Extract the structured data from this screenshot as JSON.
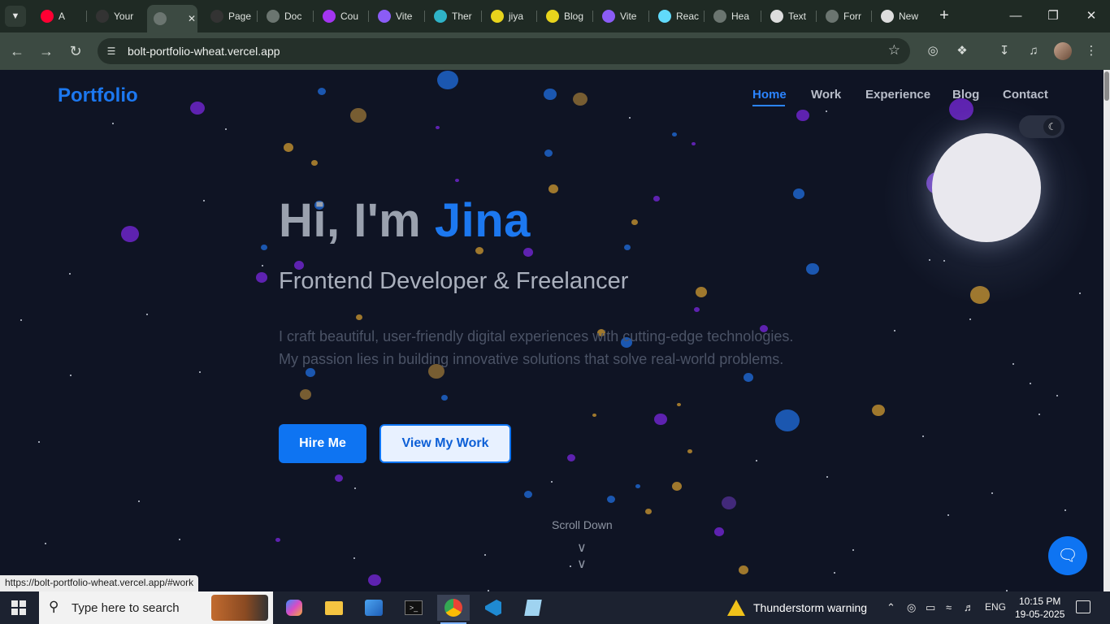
{
  "browser": {
    "tabs": [
      {
        "label": "A",
        "icon": "youtube-music-icon",
        "color": "#ff0033"
      },
      {
        "label": "Your",
        "icon": "github-icon",
        "color": "#333333"
      },
      {
        "label": "",
        "icon": "globe-icon",
        "color": "#6b7570",
        "active": true
      },
      {
        "label": "Page",
        "icon": "github-icon",
        "color": "#333333"
      },
      {
        "label": "Doc",
        "icon": "globe-icon",
        "color": "#6b7570"
      },
      {
        "label": "Cou",
        "icon": "udemy-icon",
        "color": "#a435f0"
      },
      {
        "label": "Vite",
        "icon": "vite-icon",
        "color": "#8b5cf6"
      },
      {
        "label": "Ther",
        "icon": "bot-icon",
        "color": "#2fb3c8"
      },
      {
        "label": "jiya",
        "icon": "bookmark-icon",
        "color": "#e8d41c"
      },
      {
        "label": "Blog",
        "icon": "bookmark-icon",
        "color": "#e8d41c"
      },
      {
        "label": "Vite",
        "icon": "vite-icon",
        "color": "#8b5cf6"
      },
      {
        "label": "Reac",
        "icon": "react-icon",
        "color": "#61dafb"
      },
      {
        "label": "Hea",
        "icon": "globe-icon",
        "color": "#6b7570"
      },
      {
        "label": "Text",
        "icon": "doc-icon",
        "color": "#dddddd"
      },
      {
        "label": "Forr",
        "icon": "globe-icon",
        "color": "#6b7570"
      },
      {
        "label": "New",
        "icon": "chrome-icon",
        "color": "#dddddd"
      }
    ],
    "url": "bolt-portfolio-wheat.vercel.app",
    "status_url": "https://bolt-portfolio-wheat.vercel.app/#work"
  },
  "site": {
    "logo": "Portfolio",
    "nav": [
      "Home",
      "Work",
      "Experience",
      "Blog",
      "Contact"
    ],
    "active_nav": "Home",
    "hero": {
      "title_prefix": "Hi, I'm ",
      "title_name": "Jina",
      "subtitle": "Frontend Developer & Freelancer",
      "description": "I craft beautiful, user-friendly digital experiences with cutting-edge technologies. My passion lies in building innovative solutions that solve real-world problems.",
      "primary_button": "Hire Me",
      "secondary_button": "View My Work",
      "scroll_hint": "Scroll Down"
    },
    "colors": {
      "accent": "#1c78f0",
      "background": "#0f1424"
    }
  },
  "taskbar": {
    "search_placeholder": "Type here to search",
    "weather": "Thunderstorm warning",
    "language": "ENG",
    "time": "10:15 PM",
    "date": "19-05-2025"
  }
}
